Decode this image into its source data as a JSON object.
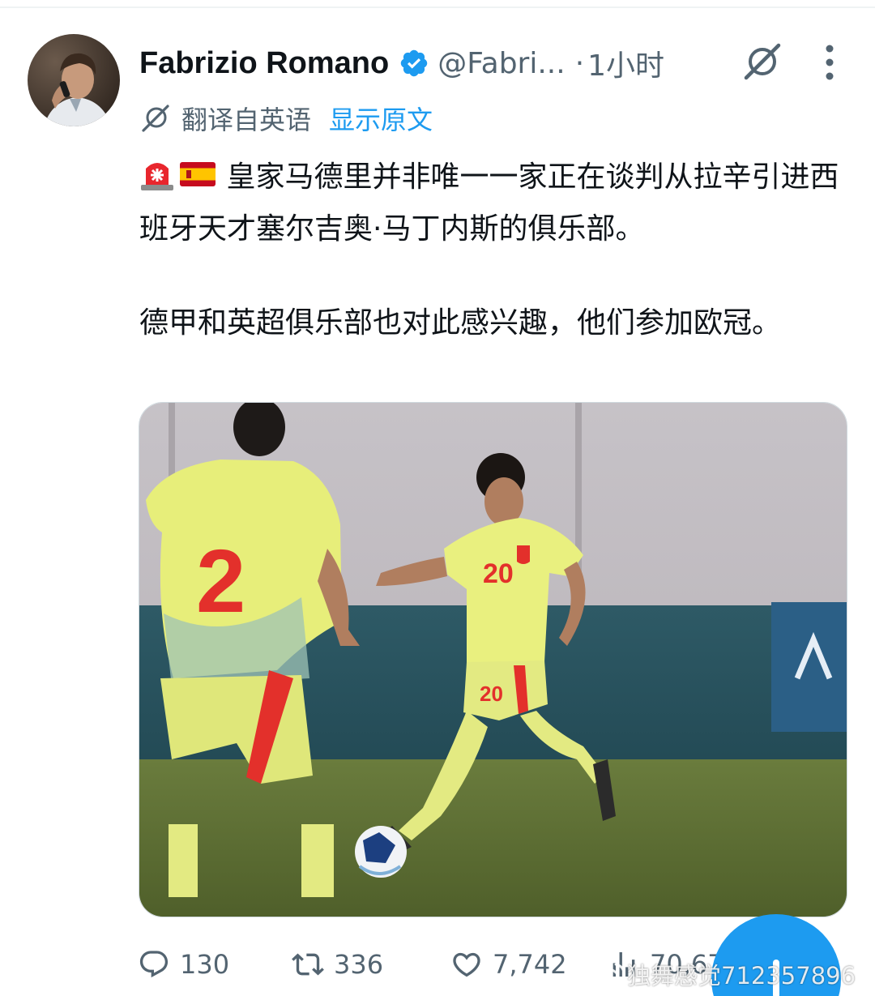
{
  "tweet": {
    "display_name": "Fabrizio Romano",
    "handle": "@Fabri...",
    "separator": "·",
    "time": "1小时",
    "translation": {
      "label": "翻译自英语",
      "show_original": "显示原文"
    },
    "paragraph_1_prefix_emojis": "🚨🇪🇸",
    "paragraph_1": "皇家马德里并非唯一一家正在谈判从拉辛引进西班牙天才塞尔吉奥·马丁内斯的俱乐部。",
    "paragraph_2": "德甲和英超俱乐部也对此感兴趣，他们参加欧冠。",
    "media": {
      "jersey_number_back": "2",
      "jersey_number_front": "20"
    },
    "actions": {
      "replies": "130",
      "reposts": "336",
      "likes": "7,742",
      "views": "70,67"
    }
  },
  "watermark": {
    "text": "独舞感觉712357896"
  },
  "colors": {
    "accent": "#1d9bf0",
    "secondary_text": "#536471",
    "primary_text": "#0f1419"
  },
  "icons": {
    "verified": "verified-badge-icon",
    "grok": "grok-icon",
    "more": "more-options-icon",
    "translate": "translate-icon",
    "reply": "reply-icon",
    "repost": "repost-icon",
    "like": "like-icon",
    "views": "views-icon"
  }
}
